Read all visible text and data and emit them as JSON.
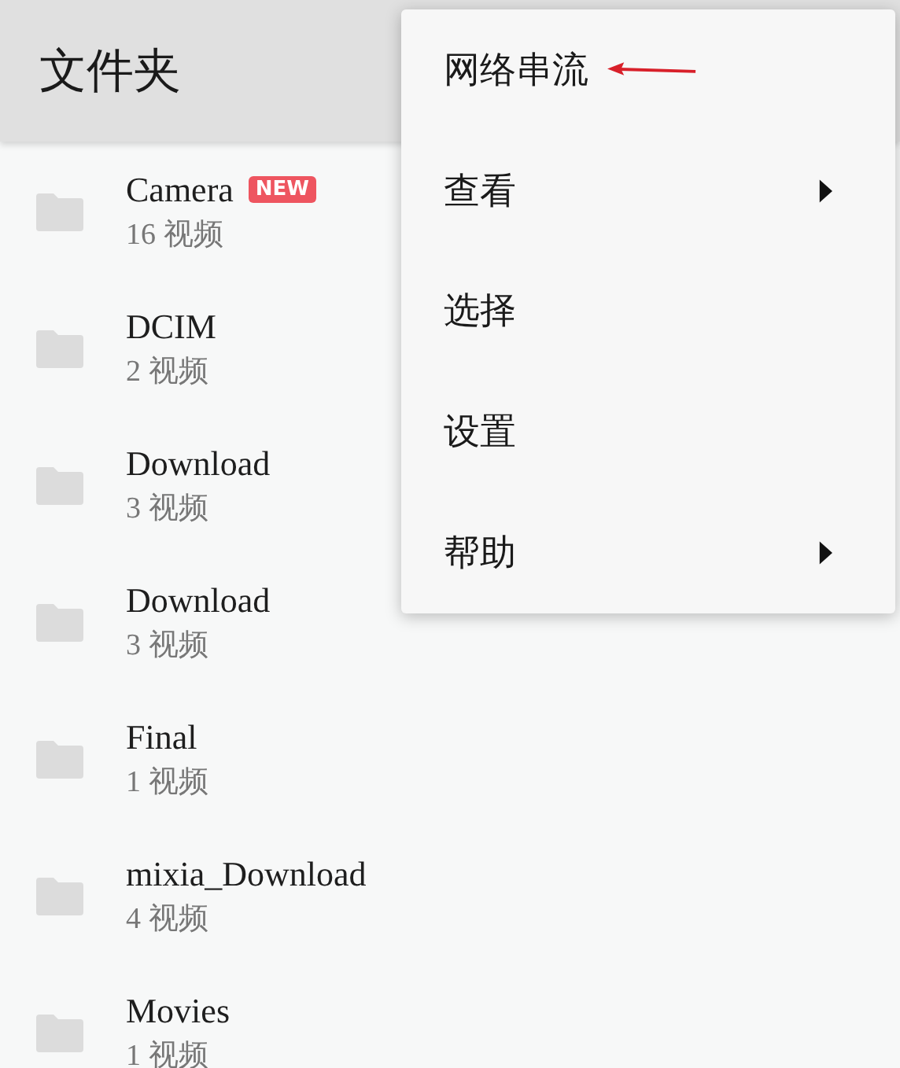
{
  "header": {
    "title": "文件夹"
  },
  "folders": [
    {
      "name": "Camera",
      "count": "16 视频",
      "badge": "NEW"
    },
    {
      "name": "DCIM",
      "count": "2 视频"
    },
    {
      "name": "Download",
      "count": "3 视频"
    },
    {
      "name": "Download",
      "count": "3 视频"
    },
    {
      "name": "Final",
      "count": "1 视频"
    },
    {
      "name": "mixia_Download",
      "count": "4 视频"
    },
    {
      "name": "Movies",
      "count": "1 视频"
    }
  ],
  "menu": {
    "items": [
      {
        "label": "网络串流",
        "has_submenu": false,
        "annotated": true
      },
      {
        "label": "查看",
        "has_submenu": true,
        "annotated": false
      },
      {
        "label": "选择",
        "has_submenu": false,
        "annotated": false
      },
      {
        "label": "设置",
        "has_submenu": false,
        "annotated": false
      },
      {
        "label": "帮助",
        "has_submenu": true,
        "annotated": false
      }
    ]
  }
}
